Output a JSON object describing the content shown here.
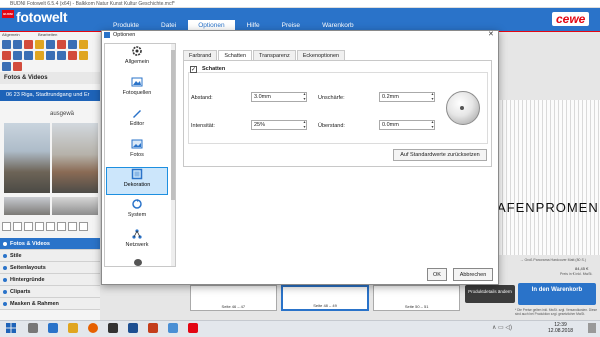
{
  "window": {
    "title": "BUDNI Fotowelt 6.5.4 (x64) - Balkkom Natur Kunst Kultur Geschichte.mcf*"
  },
  "app": {
    "brand_badge": "BUDNI",
    "brand": "fotowelt",
    "menu": [
      "Produkte",
      "Datei",
      "Optionen",
      "Hilfe",
      "Preise",
      "Warenkorb"
    ],
    "active_menu": "Optionen",
    "partner_logo": "cewe"
  },
  "left_panel": {
    "toolbar_labels": [
      "Allgemein",
      "Bearbeiten"
    ],
    "section_title": "Fotos & Videos",
    "folder": "06 23 Riga, Stadtrundgang und Er",
    "subtext": "ausgewä",
    "nav": [
      "Fotos & Videos",
      "Stile",
      "Seitenlayouts",
      "Hintergründe",
      "Cliparts",
      "Masken & Rahmen"
    ],
    "active_nav": "Fotos & Videos"
  },
  "workarea": {
    "banner_text": "AFENPROMEN",
    "product_line1": "→ Groß Panorama Hardcover Matt (80 S.)",
    "product_price": "84,45 €",
    "price_note": "Preis in € inkl. MwSt.",
    "thumbnails": [
      "Seite 46 – 47",
      "Seite 48 – 49",
      "Seite 50 – 51"
    ],
    "details_button": "Produktdetails ändern",
    "cart_button": "In den Warenkorb",
    "cart_note": "* Die Preise gelten inkl. MwSt. zzgl. Versandkosten. Diese sind auch bei Produktion zzgl. gesetzlicher MwSt."
  },
  "dialog": {
    "title": "Optionen",
    "categories": [
      {
        "label": "Allgemein",
        "icon": "gear-icon"
      },
      {
        "label": "Fotoquellen",
        "icon": "image-icon"
      },
      {
        "label": "Editor",
        "icon": "pen-icon"
      },
      {
        "label": "Fotos",
        "icon": "photo-icon"
      },
      {
        "label": "Dekoration",
        "icon": "frame-icon"
      },
      {
        "label": "System",
        "icon": "refresh-icon"
      },
      {
        "label": "Netzwerk",
        "icon": "network-icon"
      }
    ],
    "selected_category": "Dekoration",
    "tabs": [
      "Farbrand",
      "Schatten",
      "Transparenz",
      "Eckenoptionen"
    ],
    "active_tab": "Schatten",
    "shadow_checkbox": {
      "label": "Schatten",
      "checked": true
    },
    "fields": {
      "abstand_label": "Abstand:",
      "abstand_value": "3.0mm",
      "unschaerfe_label": "Unschärfe:",
      "unschaerfe_value": "0.2mm",
      "intensitaet_label": "Intensität:",
      "intensitaet_value": "25%",
      "ueberstand_label": "Überstand:",
      "ueberstand_value": "0.0mm"
    },
    "reset_button": "Auf Standardwerte zurücksetzen",
    "ok_button": "OK",
    "cancel_button": "Abbrechen"
  },
  "taskbar": {
    "time": "12:39",
    "date": "12.08.2018"
  },
  "colors": {
    "brand_blue": "#2a73c9",
    "cewe_red": "#e30613",
    "selection": "#cce6fb"
  }
}
